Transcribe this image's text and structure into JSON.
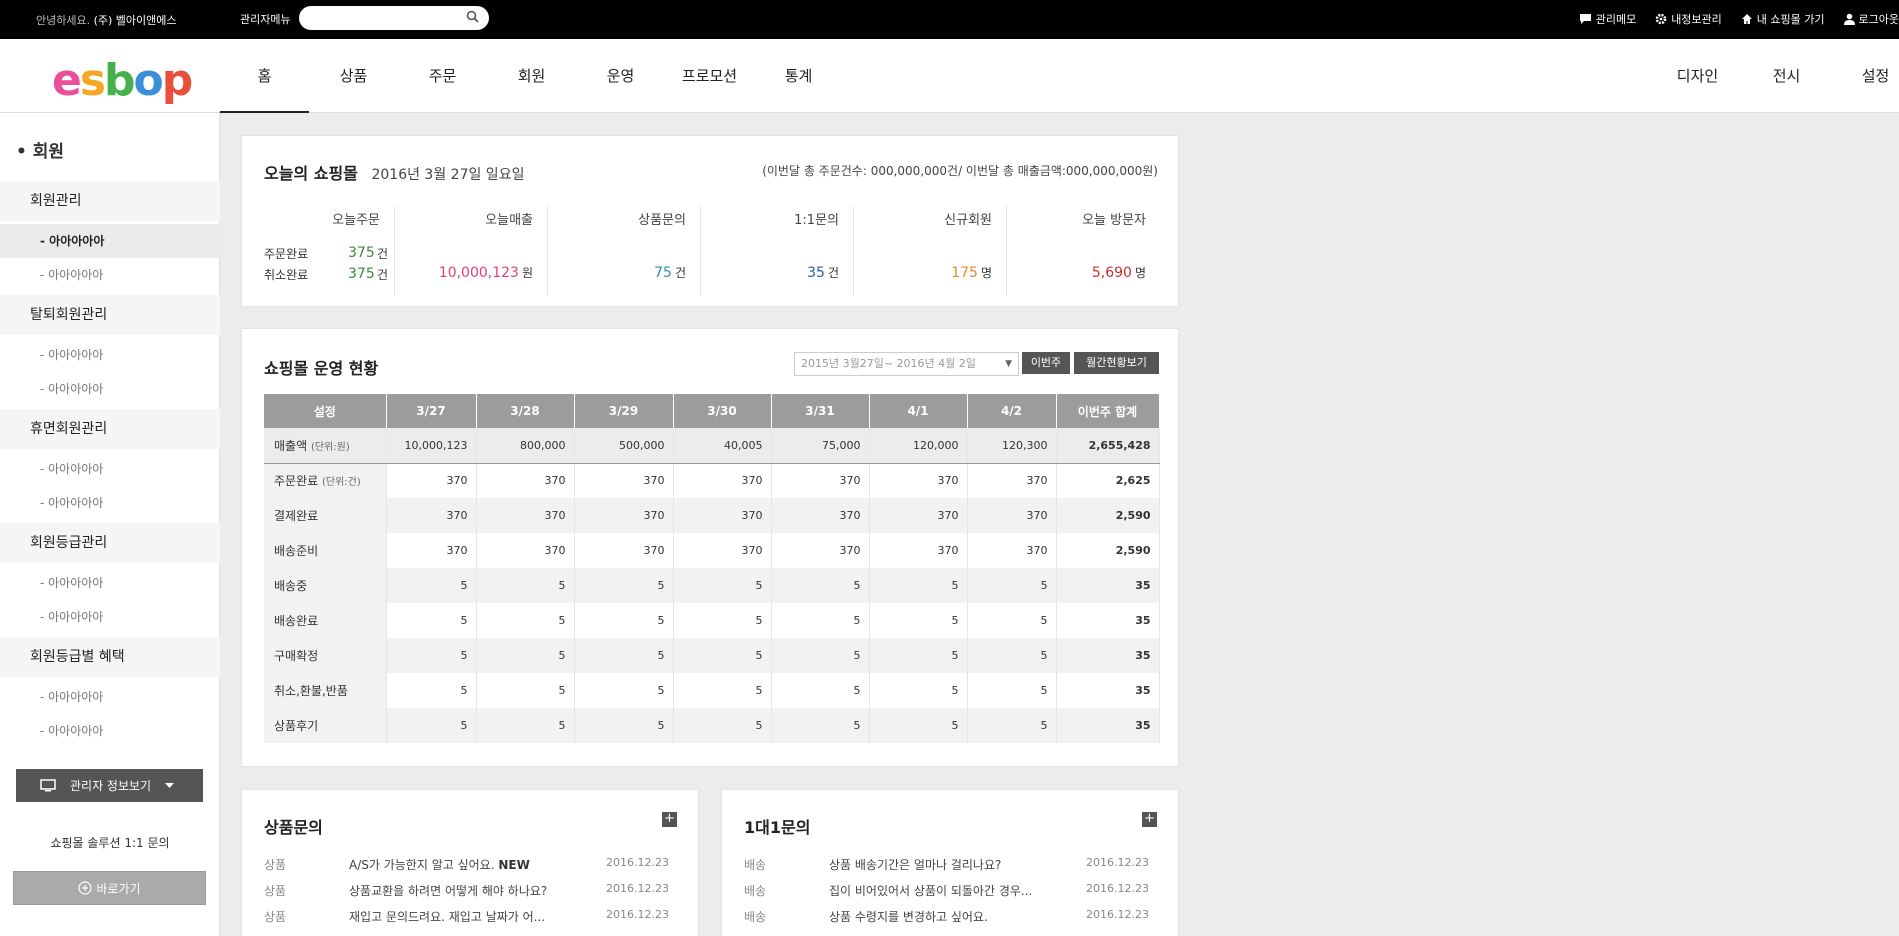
{
  "topbar": {
    "greeting": "안녕하세요.",
    "company": "(주) 벨아이앤에스",
    "admin_menu": "관리자메뉴",
    "search_placeholder": "",
    "links": [
      "관리메모",
      "내정보관리",
      "내 쇼핑몰 가기",
      "로그아웃"
    ]
  },
  "logo": {
    "text": "esbop",
    "colors": [
      "#e94f9b",
      "#f5a623",
      "#46b04a",
      "#3b8fd9",
      "#e94f3b"
    ]
  },
  "nav": {
    "main": [
      "홈",
      "상품",
      "주문",
      "회원",
      "운영",
      "프로모션",
      "통계"
    ],
    "right": [
      "디자인",
      "전시",
      "설정"
    ],
    "active": "홈"
  },
  "sidebar": {
    "title": "회원",
    "groups": [
      {
        "label": "회원관리",
        "items": [
          "- 아아아아아",
          "- 아아아아아"
        ]
      },
      {
        "label": "탈퇴회원관리",
        "items": [
          "- 아아아아아",
          "- 아아아아아"
        ]
      },
      {
        "label": "휴면회원관리",
        "items": [
          "- 아아아아아",
          "- 아아아아아"
        ]
      },
      {
        "label": "회원등급관리",
        "items": [
          "- 아아아아아",
          "- 아아아아아"
        ]
      },
      {
        "label": "회원등급별 혜택",
        "items": [
          "- 아아아아아",
          "- 아아아아아"
        ]
      }
    ],
    "admin_button": "관리자 정보보기",
    "support_text": "쇼핑몰 솔루션 1:1 문의",
    "go_button": "바로가기"
  },
  "today": {
    "title": "오늘의 쇼핑몰",
    "date": "2016년 3월 27일 일요일",
    "summary": "(이번달 총 주문건수: 000,000,000건/ 이번달 총 매출금액:000,000,000원)",
    "orders_header": "오늘주문",
    "order_rows": [
      {
        "label": "주문완료",
        "value": "375",
        "unit": "건"
      },
      {
        "label": "취소완료",
        "value": "375",
        "unit": "건"
      }
    ],
    "cols": [
      {
        "header": "오늘매출",
        "value": "10,000,123",
        "unit": "원",
        "color": "#e2407a"
      },
      {
        "header": "상품문의",
        "value": "75",
        "unit": "건",
        "color": "#2f8fb5"
      },
      {
        "header": "1:1문의",
        "value": "35",
        "unit": "건",
        "color": "#2b5f9e"
      },
      {
        "header": "신규회원",
        "value": "175",
        "unit": "명",
        "color": "#e98a27"
      },
      {
        "header": "오늘 방문자",
        "value": "5,690",
        "unit": "명",
        "color": "#c43131"
      }
    ]
  },
  "status": {
    "title": "쇼핑몰 운영 현황",
    "date_range": "2015년 3월27일~ 2016년 4월 2일",
    "btn_week": "이번주",
    "btn_month": "월간현황보기",
    "headers": [
      "설정",
      "3/27",
      "3/28",
      "3/29",
      "3/30",
      "3/31",
      "4/1",
      "4/2",
      "이번주 합계"
    ],
    "rows": [
      {
        "label": "매출액",
        "sub": "(단위:원)",
        "values": [
          "10,000,123",
          "800,000",
          "500,000",
          "40,005",
          "75,000",
          "120,000",
          "120,300",
          "2,655,428"
        ]
      },
      {
        "label": "주문완료",
        "sub": "(단위:건)",
        "values": [
          "370",
          "370",
          "370",
          "370",
          "370",
          "370",
          "370",
          "2,625"
        ]
      },
      {
        "label": "결제완료",
        "sub": "",
        "values": [
          "370",
          "370",
          "370",
          "370",
          "370",
          "370",
          "370",
          "2,590"
        ]
      },
      {
        "label": "배송준비",
        "sub": "",
        "values": [
          "370",
          "370",
          "370",
          "370",
          "370",
          "370",
          "370",
          "2,590"
        ]
      },
      {
        "label": "배송중",
        "sub": "",
        "values": [
          "5",
          "5",
          "5",
          "5",
          "5",
          "5",
          "5",
          "35"
        ]
      },
      {
        "label": "배송완료",
        "sub": "",
        "values": [
          "5",
          "5",
          "5",
          "5",
          "5",
          "5",
          "5",
          "35"
        ]
      },
      {
        "label": "구매확정",
        "sub": "",
        "values": [
          "5",
          "5",
          "5",
          "5",
          "5",
          "5",
          "5",
          "35"
        ]
      },
      {
        "label": "취소,환불,반품",
        "sub": "",
        "values": [
          "5",
          "5",
          "5",
          "5",
          "5",
          "5",
          "5",
          "35"
        ]
      },
      {
        "label": "상품후기",
        "sub": "",
        "values": [
          "5",
          "5",
          "5",
          "5",
          "5",
          "5",
          "5",
          "35"
        ]
      }
    ]
  },
  "product_qna": {
    "title": "상품문의",
    "items": [
      {
        "cat": "상품",
        "title": "A/S가 가능한지 알고 싶어요.",
        "new": "NEW",
        "date": "2016.12.23"
      },
      {
        "cat": "상품",
        "title": "상품교환을 하려면 어떻게 해야 하나요?",
        "new": "",
        "date": "2016.12.23"
      },
      {
        "cat": "상품",
        "title": "재입고 문의드려요. 재입고 날짜가 어...",
        "new": "",
        "date": "2016.12.23"
      }
    ]
  },
  "one_qna": {
    "title": "1대1문의",
    "items": [
      {
        "cat": "배송",
        "title": "상품 배송기간은 얼마나 걸리나요?",
        "new": "",
        "date": "2016.12.23"
      },
      {
        "cat": "배송",
        "title": "집이 비어있어서 상품이 되돌아간 경우...",
        "new": "",
        "date": "2016.12.23"
      },
      {
        "cat": "배송",
        "title": "상품 수령지를 변경하고 싶어요.",
        "new": "",
        "date": "2016.12.23"
      }
    ]
  }
}
